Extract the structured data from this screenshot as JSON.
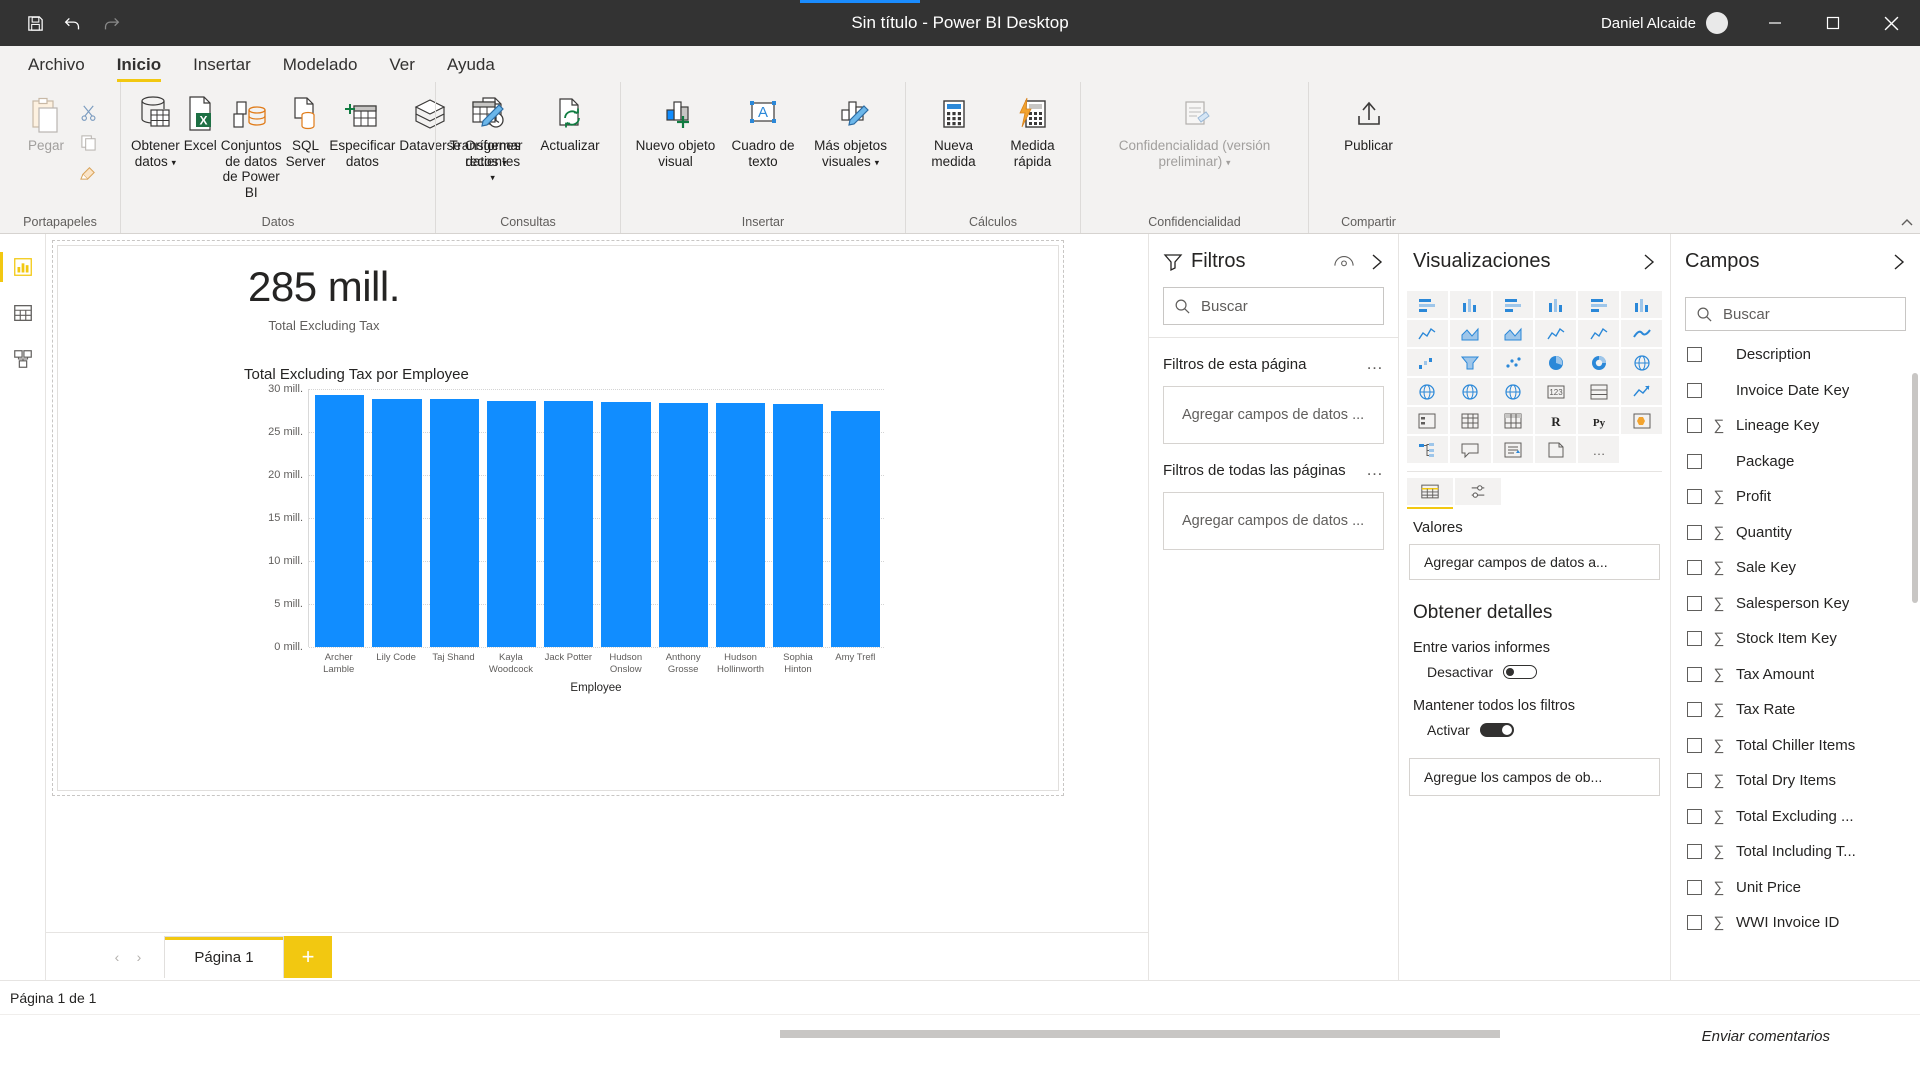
{
  "titlebar": {
    "title": "Sin título - Power BI Desktop",
    "user": "Daniel Alcaide",
    "save_icon": "save-icon",
    "undo_icon": "undo-icon",
    "redo_icon": "redo-icon",
    "minimize": "–",
    "maximize": "□",
    "close": "✕"
  },
  "menubar": {
    "items": [
      {
        "label": "Archivo",
        "active": false
      },
      {
        "label": "Inicio",
        "active": true
      },
      {
        "label": "Insertar",
        "active": false
      },
      {
        "label": "Modelado",
        "active": false
      },
      {
        "label": "Ver",
        "active": false
      },
      {
        "label": "Ayuda",
        "active": false
      }
    ]
  },
  "ribbon": {
    "groups": [
      {
        "label": "Portapapeles"
      },
      {
        "label": "Datos"
      },
      {
        "label": "Consultas"
      },
      {
        "label": "Insertar"
      },
      {
        "label": "Cálculos"
      },
      {
        "label": "Confidencialidad"
      },
      {
        "label": "Compartir"
      }
    ],
    "clipboard": {
      "paste": "Pegar",
      "cut": "cut-icon",
      "copy": "copy-icon",
      "format_painter": "format-painter-icon"
    },
    "buttons": {
      "obtener_datos": "Obtener datos",
      "excel": "Excel",
      "conjuntos_datos_powerbi": "Conjuntos de datos de Power BI",
      "sql_server": "SQL Server",
      "especificar_datos": "Especificar datos",
      "dataverse": "Dataverse",
      "origenes_recientes": "Orígenes recientes",
      "transformar_datos": "Transformar datos",
      "actualizar": "Actualizar",
      "nuevo_objeto_visual": "Nuevo objeto visual",
      "cuadro_de_texto": "Cuadro de texto",
      "mas_objetos_visuales": "Más objetos visuales",
      "nueva_medida": "Nueva medida",
      "medida_rapida": "Medida rápida",
      "confidencialidad": "Confidencialidad (versión preliminar)",
      "publicar": "Publicar"
    }
  },
  "rail": {
    "items": [
      {
        "name": "report-view",
        "icon": "report-bar-chart-icon",
        "active": true
      },
      {
        "name": "data-view",
        "icon": "table-grid-icon",
        "active": false
      },
      {
        "name": "model-view",
        "icon": "model-relationship-icon",
        "active": false
      }
    ]
  },
  "chart_data": {
    "type": "bar",
    "title": "Total Excluding Tax por Employee",
    "xlabel": "Employee",
    "ylabel": "Total Excluding Tax",
    "ylim": [
      0,
      30
    ],
    "ytick_labels": [
      "30 mill.",
      "25 mill.",
      "20 mill.",
      "15 mill.",
      "10 mill.",
      "5 mill.",
      "0 mill."
    ],
    "yticks": [
      30,
      25,
      20,
      15,
      10,
      5,
      0
    ],
    "grid": true,
    "legend": "none",
    "bar_color": "#118dff",
    "categories": [
      "Archer Lamble",
      "Lily Code",
      "Taj Shand",
      "Kayla Woodcock",
      "Jack Potter",
      "Hudson Onslow",
      "Anthony Grosse",
      "Hudson Hollinworth",
      "Sophia Hinton",
      "Amy Trefl"
    ],
    "values": [
      29.3,
      28.8,
      28.8,
      28.6,
      28.6,
      28.5,
      28.4,
      28.4,
      28.3,
      27.5
    ],
    "kpi": {
      "value": "285 mill.",
      "label": "Total Excluding Tax"
    }
  },
  "pagebar": {
    "prev": "‹",
    "next": "›",
    "tabs": [
      {
        "label": "Página 1",
        "active": true
      }
    ],
    "add_label": "+"
  },
  "filters_panel": {
    "title": "Filtros",
    "eye_icon": "eye-icon",
    "expand_icon": "chevron-right-icon",
    "search_placeholder": "Buscar",
    "search_value": "",
    "sections": [
      {
        "label": "Filtros de esta página",
        "menu": "…",
        "dropzone": "Agregar campos de datos ..."
      },
      {
        "label": "Filtros de todas las páginas",
        "menu": "…",
        "dropzone": "Agregar campos de datos ..."
      }
    ]
  },
  "viz_panel": {
    "title": "Visualizaciones",
    "expand_icon": "chevron-right-icon",
    "icons": [
      "stacked-bar-chart",
      "stacked-column-chart",
      "clustered-bar-chart",
      "clustered-column-chart",
      "100-stacked-bar",
      "100-stacked-column",
      "line-chart",
      "area-chart",
      "stacked-area-chart",
      "line-stacked-column",
      "line-clustered-column",
      "ribbon-chart",
      "waterfall-chart",
      "funnel-chart",
      "scatter-chart",
      "pie-chart",
      "donut-chart",
      "treemap",
      "map",
      "filled-map",
      "arcgis-map",
      "card",
      "multi-row-card",
      "kpi",
      "slicer",
      "table",
      "matrix",
      "r-script-visual",
      "python-visual",
      "key-influencers",
      "decomposition-tree",
      "q-and-a",
      "smart-narrative",
      "paginated-report",
      "more-options"
    ],
    "icon_labels": {
      "r": "R",
      "py": "Py"
    },
    "row2": [
      "values-format-icon",
      "format-paint-icon"
    ],
    "values_label": "Valores",
    "values_placeholder": "Agregar campos de datos a...",
    "drill_title": "Obtener detalles",
    "drill_items": [
      {
        "label": "Entre varios informes",
        "toggle_label": "Desactivar",
        "state": "off"
      },
      {
        "label": "Mantener todos los filtros",
        "toggle_label": "Activar",
        "state": "on"
      }
    ],
    "drill_dropzone": "Agregue los campos de ob..."
  },
  "campos_panel": {
    "title": "Campos",
    "expand_icon": "chevron-right-icon",
    "search_placeholder": "Buscar",
    "search_value": "",
    "fields": [
      {
        "name": "Description",
        "aggregate": false
      },
      {
        "name": "Invoice Date Key",
        "aggregate": false
      },
      {
        "name": "Lineage Key",
        "aggregate": true
      },
      {
        "name": "Package",
        "aggregate": false
      },
      {
        "name": "Profit",
        "aggregate": true
      },
      {
        "name": "Quantity",
        "aggregate": true
      },
      {
        "name": "Sale Key",
        "aggregate": true
      },
      {
        "name": "Salesperson Key",
        "aggregate": true
      },
      {
        "name": "Stock Item Key",
        "aggregate": true
      },
      {
        "name": "Tax Amount",
        "aggregate": true
      },
      {
        "name": "Tax Rate",
        "aggregate": true
      },
      {
        "name": "Total Chiller Items",
        "aggregate": true
      },
      {
        "name": "Total Dry Items",
        "aggregate": true
      },
      {
        "name": "Total Excluding ...",
        "aggregate": true
      },
      {
        "name": "Total Including T...",
        "aggregate": true
      },
      {
        "name": "Unit Price",
        "aggregate": true
      },
      {
        "name": "WWI Invoice ID",
        "aggregate": true
      }
    ],
    "sigma": "∑"
  },
  "statusbar": {
    "text": "Página 1 de 1"
  },
  "footer": {
    "feedback": "Enviar comentarios"
  },
  "colors": {
    "accent_yellow": "#f2c811",
    "bar_blue": "#118dff",
    "titlebar_bg": "#333333",
    "ribbon_bg": "#f3f2f1"
  }
}
